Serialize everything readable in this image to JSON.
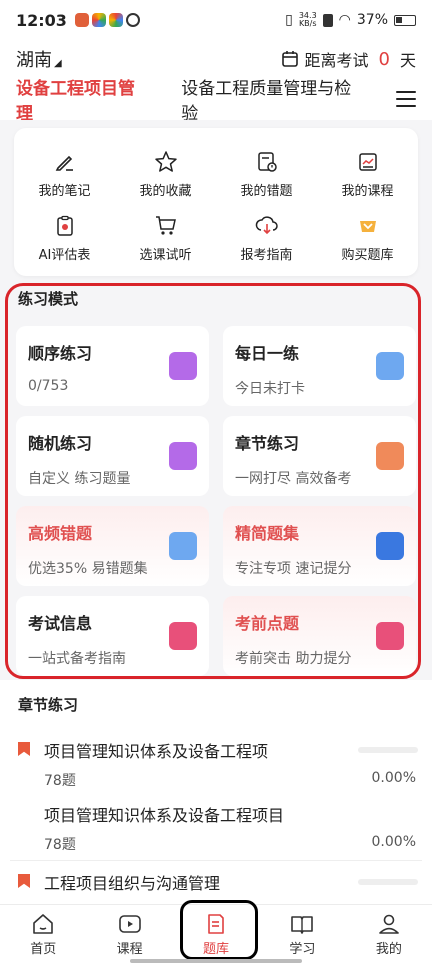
{
  "status": {
    "time": "12:03",
    "net_speed": "34.3",
    "net_unit": "KB/s",
    "battery": "37%"
  },
  "header": {
    "location": "湖南",
    "exam_prefix": "距离考试",
    "exam_days": "0",
    "exam_suffix": "天"
  },
  "tabs": [
    {
      "label": "设备工程项目管理",
      "active": true
    },
    {
      "label": "设备工程质量管理与检验",
      "active": false
    }
  ],
  "quick": [
    {
      "label": "我的笔记",
      "icon": "pencil-icon"
    },
    {
      "label": "我的收藏",
      "icon": "star-icon"
    },
    {
      "label": "我的错题",
      "icon": "wrong-questions-icon"
    },
    {
      "label": "我的课程",
      "icon": "course-icon"
    },
    {
      "label": "AI评估表",
      "icon": "ai-assessment-icon"
    },
    {
      "label": "选课试听",
      "icon": "cart-icon"
    },
    {
      "label": "报考指南",
      "icon": "guide-icon"
    },
    {
      "label": "购买题库",
      "icon": "buy-bank-icon"
    }
  ],
  "practice": {
    "title": "练习模式",
    "cards": [
      {
        "title": "顺序练习",
        "sub": "0/753",
        "color": "#b46ae8"
      },
      {
        "title": "每日一练",
        "sub": "今日未打卡",
        "color": "#6ea8f0"
      },
      {
        "title": "随机练习",
        "sub": "自定义 练习题量",
        "color": "#b46ae8"
      },
      {
        "title": "章节练习",
        "sub": "一网打尽 高效备考",
        "color": "#f08a5a"
      },
      {
        "title": "高频错题",
        "sub": "优选35% 易错题集",
        "color": "#6ea8f0"
      },
      {
        "title": "精简题集",
        "sub": "专注专项 速记提分",
        "color": "#3a78e0"
      },
      {
        "title": "考试信息",
        "sub": "一站式备考指南",
        "color": "#e8507a"
      },
      {
        "title": "考前点题",
        "sub": "考前突击 助力提分",
        "color": "#e8507a"
      }
    ]
  },
  "chapters": {
    "title": "章节练习",
    "items": [
      {
        "name": "项目管理知识体系及设备工程项",
        "count": "78题",
        "pct": "0.00%",
        "progress": 0
      },
      {
        "name": "项目管理知识体系及设备工程项目",
        "count": "78题",
        "pct": "0.00%",
        "progress": 0
      },
      {
        "name": "工程项目组织与沟通管理",
        "count": "",
        "pct": "",
        "progress": 0
      }
    ]
  },
  "nav": [
    {
      "label": "首页",
      "icon": "home-icon"
    },
    {
      "label": "课程",
      "icon": "play-icon"
    },
    {
      "label": "题库",
      "icon": "question-bank-icon",
      "active": true
    },
    {
      "label": "学习",
      "icon": "book-icon"
    },
    {
      "label": "我的",
      "icon": "profile-icon"
    }
  ]
}
